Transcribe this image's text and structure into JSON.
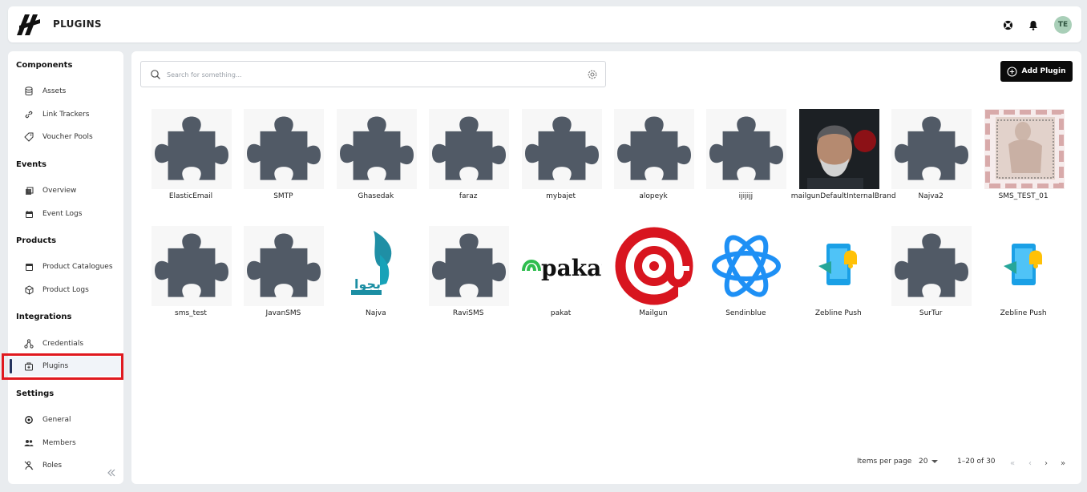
{
  "header": {
    "title": "PLUGINS",
    "avatar_initials": "TE",
    "icons": [
      "support-icon",
      "bell-icon"
    ]
  },
  "sidebar": {
    "sections": [
      {
        "title": "Components",
        "items": [
          {
            "label": "Assets",
            "icon": "database-icon"
          },
          {
            "label": "Link Trackers",
            "icon": "link-icon"
          },
          {
            "label": "Voucher Pools",
            "icon": "tag-icon"
          }
        ]
      },
      {
        "title": "Events",
        "items": [
          {
            "label": "Overview",
            "icon": "overview-icon"
          },
          {
            "label": "Event Logs",
            "icon": "calendar-icon"
          }
        ]
      },
      {
        "title": "Products",
        "items": [
          {
            "label": "Product Catalogues",
            "icon": "catalogue-icon"
          },
          {
            "label": "Product Logs",
            "icon": "box-icon"
          }
        ]
      },
      {
        "title": "Integrations",
        "items": [
          {
            "label": "Credentials",
            "icon": "share-icon"
          },
          {
            "label": "Plugins",
            "icon": "plugin-bag-icon",
            "active": true
          }
        ]
      },
      {
        "title": "Settings",
        "items": [
          {
            "label": "General",
            "icon": "gear-icon"
          },
          {
            "label": "Members",
            "icon": "users-icon"
          },
          {
            "label": "Roles",
            "icon": "roles-icon"
          }
        ]
      }
    ]
  },
  "search": {
    "placeholder": "Search for something..."
  },
  "add_button": {
    "label": "Add Plugin"
  },
  "plugins": [
    {
      "name": "ElasticEmail",
      "image": "puzzle"
    },
    {
      "name": "SMTP",
      "image": "puzzle"
    },
    {
      "name": "Ghasedak",
      "image": "puzzle"
    },
    {
      "name": "faraz",
      "image": "puzzle"
    },
    {
      "name": "mybajet",
      "image": "puzzle"
    },
    {
      "name": "alopeyk",
      "image": "puzzle"
    },
    {
      "name": "ijijijj",
      "image": "puzzle"
    },
    {
      "name": "mailgunDefaultInternalBrand",
      "image": "portrait-photo"
    },
    {
      "name": "Najva2",
      "image": "puzzle"
    },
    {
      "name": "SMS_TEST_01",
      "image": "statue-photo"
    },
    {
      "name": "sms_test",
      "image": "puzzle"
    },
    {
      "name": "JavanSMS",
      "image": "puzzle"
    },
    {
      "name": "Najva",
      "image": "najva-logo"
    },
    {
      "name": "RaviSMS",
      "image": "puzzle"
    },
    {
      "name": "pakat",
      "image": "pakat-logo",
      "logo_text": "pakat"
    },
    {
      "name": "Mailgun",
      "image": "mailgun-logo"
    },
    {
      "name": "Sendinblue",
      "image": "sendinblue-logo"
    },
    {
      "name": "Zebline Push",
      "image": "push-logo"
    },
    {
      "name": "SurTur",
      "image": "puzzle"
    },
    {
      "name": "Zebline Push",
      "image": "push-logo"
    }
  ],
  "pagination": {
    "items_per_page_label": "Items per page",
    "page_size": "20",
    "range": "1–20 of 30"
  },
  "colors": {
    "puzzle": "#515a66",
    "accent": "#25335f",
    "highlight": "#e0191f"
  }
}
